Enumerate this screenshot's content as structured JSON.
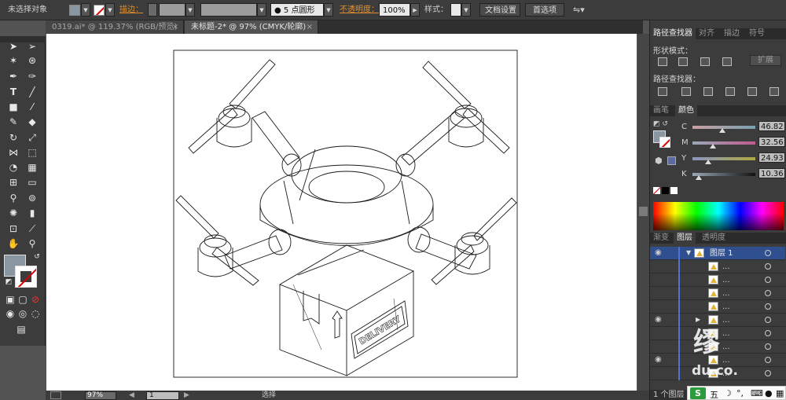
{
  "control_bar": {
    "selection_status": "未选择对象",
    "stroke_label": "描边：",
    "brush": "5 点圆形",
    "opacity_label": "不透明度：",
    "opacity_value": "100%",
    "style_label": "样式：",
    "doc_settings": "文档设置",
    "preferences": "首选项"
  },
  "tabs": [
    {
      "label": "0319.ai* @ 119.37% (RGB/预览)"
    },
    {
      "label": "未标题-2* @ 97% (CMYK/轮廓)"
    }
  ],
  "pathfinder": {
    "tabs": [
      "路径查找器",
      "对齐",
      "描边",
      "符号"
    ],
    "shape_modes": "形状模式：",
    "expand": "扩展",
    "pathfinders": "路径查找器："
  },
  "color": {
    "tabs": [
      "画笔",
      "颜色"
    ],
    "channels": [
      {
        "name": "C",
        "value": "46.82",
        "level": 0.47
      },
      {
        "name": "M",
        "value": "32.56",
        "level": 0.33
      },
      {
        "name": "Y",
        "value": "24.93",
        "level": 0.25
      },
      {
        "name": "K",
        "value": "10.36",
        "level": 0.1
      }
    ],
    "fill_color": "#8a96a2"
  },
  "layers": {
    "tabs": [
      "渐变",
      "图层",
      "透明度"
    ],
    "top_layer": "图层 1",
    "sublayer_name": "...",
    "status": "1 个图层"
  },
  "status_bar": {
    "zoom": "97%",
    "page": "1",
    "tool": "选择"
  },
  "watermark": {
    "char": "缪",
    "text": "du.co."
  },
  "ime": {
    "logo": "S",
    "mode": "五"
  }
}
